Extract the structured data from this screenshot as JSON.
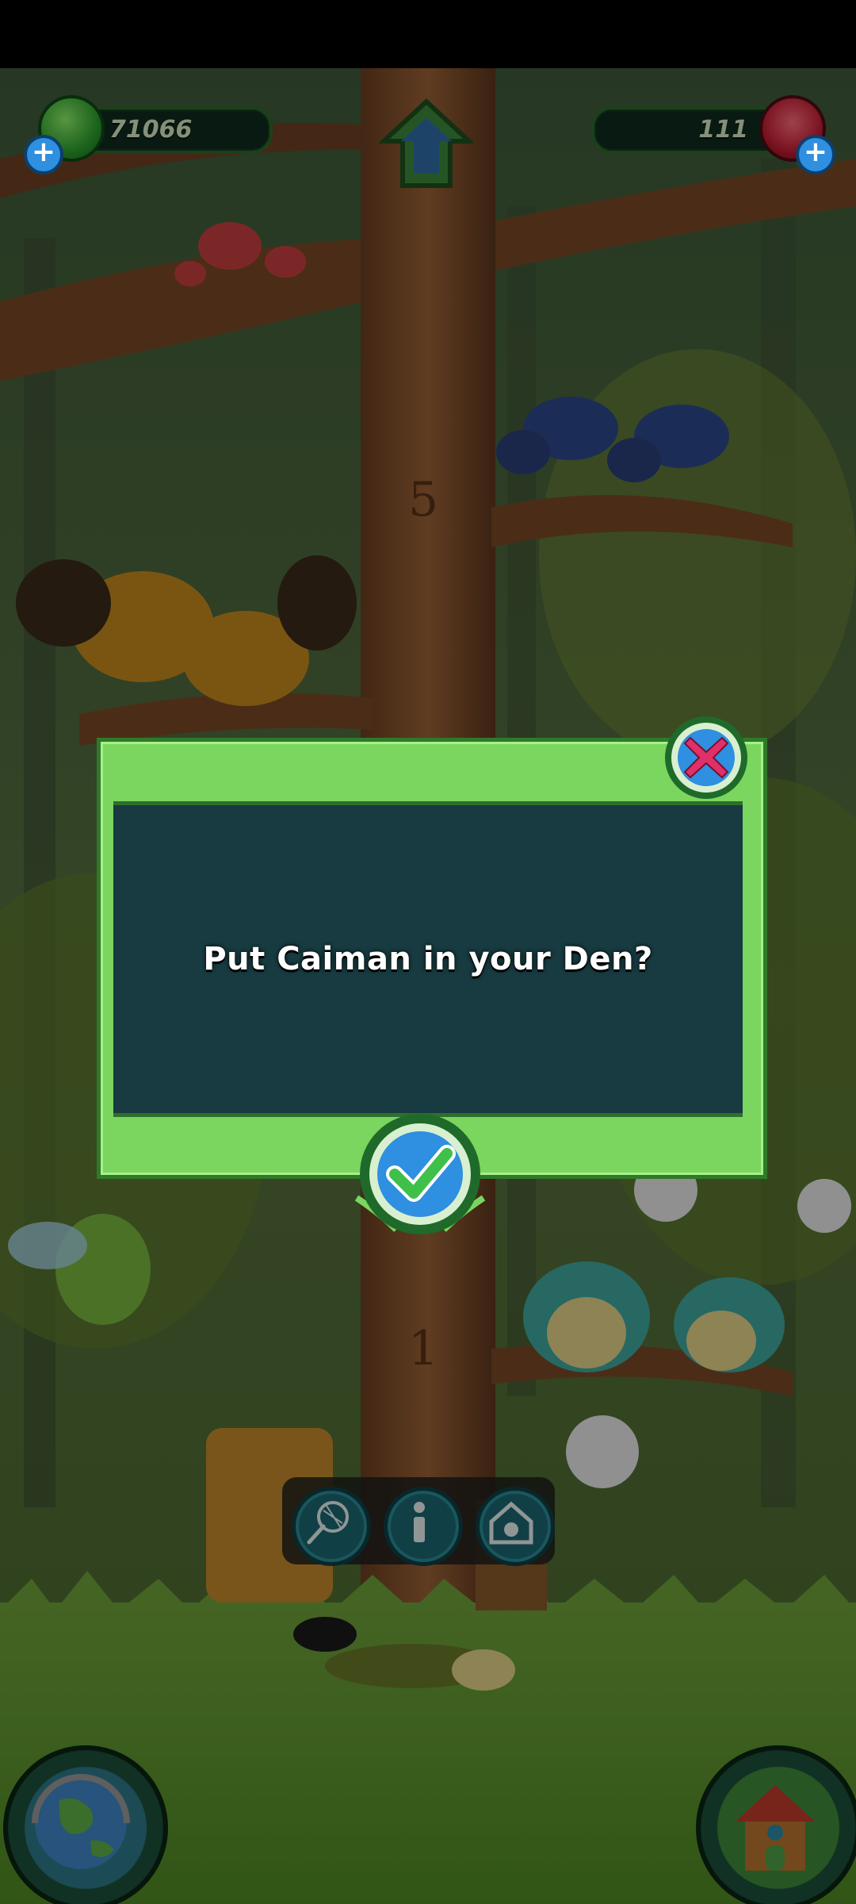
{
  "hud": {
    "currency_left": "71066",
    "currency_right": "111",
    "icons": {
      "left": "green-gem-icon",
      "left_add": "plus-icon",
      "center": "home-arrow-icon",
      "right": "red-crystal-icon",
      "right_add": "plus-icon"
    }
  },
  "dialog": {
    "message": "Put Caiman in your Den?",
    "close_icon": "close-x-icon",
    "confirm_icon": "checkmark-icon"
  },
  "toolbar": {
    "items": [
      {
        "icon": "net-icon"
      },
      {
        "icon": "info-icon"
      },
      {
        "icon": "den-icon"
      }
    ]
  },
  "corner_buttons": {
    "left": "globe-icon",
    "right": "treehouse-icon"
  },
  "colors": {
    "dialog_frame": "#7ad65e",
    "dialog_inner": "#173b40",
    "close_accent": "#e0306a",
    "confirm_accent": "#2f8fe0"
  }
}
